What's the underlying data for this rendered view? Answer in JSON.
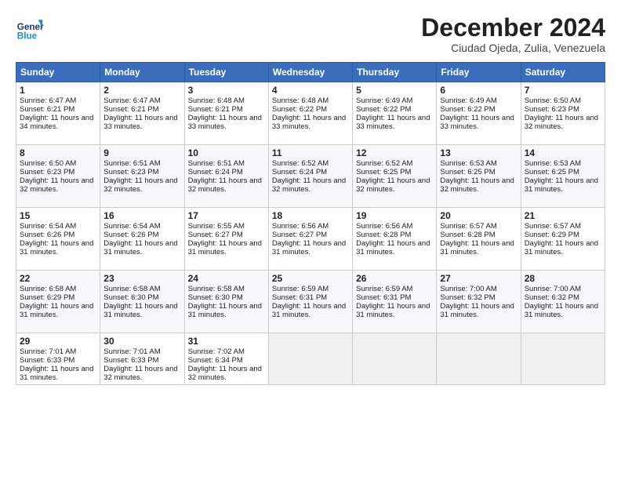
{
  "header": {
    "logo_line1": "General",
    "logo_line2": "Blue",
    "month_title": "December 2024",
    "location": "Ciudad Ojeda, Zulia, Venezuela"
  },
  "weekdays": [
    "Sunday",
    "Monday",
    "Tuesday",
    "Wednesday",
    "Thursday",
    "Friday",
    "Saturday"
  ],
  "weeks": [
    [
      {
        "day": "1",
        "sunrise": "6:47 AM",
        "sunset": "6:21 PM",
        "daylight": "11 hours and 34 minutes."
      },
      {
        "day": "2",
        "sunrise": "6:47 AM",
        "sunset": "6:21 PM",
        "daylight": "11 hours and 33 minutes."
      },
      {
        "day": "3",
        "sunrise": "6:48 AM",
        "sunset": "6:21 PM",
        "daylight": "11 hours and 33 minutes."
      },
      {
        "day": "4",
        "sunrise": "6:48 AM",
        "sunset": "6:22 PM",
        "daylight": "11 hours and 33 minutes."
      },
      {
        "day": "5",
        "sunrise": "6:49 AM",
        "sunset": "6:22 PM",
        "daylight": "11 hours and 33 minutes."
      },
      {
        "day": "6",
        "sunrise": "6:49 AM",
        "sunset": "6:22 PM",
        "daylight": "11 hours and 33 minutes."
      },
      {
        "day": "7",
        "sunrise": "6:50 AM",
        "sunset": "6:23 PM",
        "daylight": "11 hours and 32 minutes."
      }
    ],
    [
      {
        "day": "8",
        "sunrise": "6:50 AM",
        "sunset": "6:23 PM",
        "daylight": "11 hours and 32 minutes."
      },
      {
        "day": "9",
        "sunrise": "6:51 AM",
        "sunset": "6:23 PM",
        "daylight": "11 hours and 32 minutes."
      },
      {
        "day": "10",
        "sunrise": "6:51 AM",
        "sunset": "6:24 PM",
        "daylight": "11 hours and 32 minutes."
      },
      {
        "day": "11",
        "sunrise": "6:52 AM",
        "sunset": "6:24 PM",
        "daylight": "11 hours and 32 minutes."
      },
      {
        "day": "12",
        "sunrise": "6:52 AM",
        "sunset": "6:25 PM",
        "daylight": "11 hours and 32 minutes."
      },
      {
        "day": "13",
        "sunrise": "6:53 AM",
        "sunset": "6:25 PM",
        "daylight": "11 hours and 32 minutes."
      },
      {
        "day": "14",
        "sunrise": "6:53 AM",
        "sunset": "6:25 PM",
        "daylight": "11 hours and 31 minutes."
      }
    ],
    [
      {
        "day": "15",
        "sunrise": "6:54 AM",
        "sunset": "6:26 PM",
        "daylight": "11 hours and 31 minutes."
      },
      {
        "day": "16",
        "sunrise": "6:54 AM",
        "sunset": "6:26 PM",
        "daylight": "11 hours and 31 minutes."
      },
      {
        "day": "17",
        "sunrise": "6:55 AM",
        "sunset": "6:27 PM",
        "daylight": "11 hours and 31 minutes."
      },
      {
        "day": "18",
        "sunrise": "6:56 AM",
        "sunset": "6:27 PM",
        "daylight": "11 hours and 31 minutes."
      },
      {
        "day": "19",
        "sunrise": "6:56 AM",
        "sunset": "6:28 PM",
        "daylight": "11 hours and 31 minutes."
      },
      {
        "day": "20",
        "sunrise": "6:57 AM",
        "sunset": "6:28 PM",
        "daylight": "11 hours and 31 minutes."
      },
      {
        "day": "21",
        "sunrise": "6:57 AM",
        "sunset": "6:29 PM",
        "daylight": "11 hours and 31 minutes."
      }
    ],
    [
      {
        "day": "22",
        "sunrise": "6:58 AM",
        "sunset": "6:29 PM",
        "daylight": "11 hours and 31 minutes."
      },
      {
        "day": "23",
        "sunrise": "6:58 AM",
        "sunset": "6:30 PM",
        "daylight": "11 hours and 31 minutes."
      },
      {
        "day": "24",
        "sunrise": "6:58 AM",
        "sunset": "6:30 PM",
        "daylight": "11 hours and 31 minutes."
      },
      {
        "day": "25",
        "sunrise": "6:59 AM",
        "sunset": "6:31 PM",
        "daylight": "11 hours and 31 minutes."
      },
      {
        "day": "26",
        "sunrise": "6:59 AM",
        "sunset": "6:31 PM",
        "daylight": "11 hours and 31 minutes."
      },
      {
        "day": "27",
        "sunrise": "7:00 AM",
        "sunset": "6:32 PM",
        "daylight": "11 hours and 31 minutes."
      },
      {
        "day": "28",
        "sunrise": "7:00 AM",
        "sunset": "6:32 PM",
        "daylight": "11 hours and 31 minutes."
      }
    ],
    [
      {
        "day": "29",
        "sunrise": "7:01 AM",
        "sunset": "6:33 PM",
        "daylight": "11 hours and 31 minutes."
      },
      {
        "day": "30",
        "sunrise": "7:01 AM",
        "sunset": "6:33 PM",
        "daylight": "11 hours and 32 minutes."
      },
      {
        "day": "31",
        "sunrise": "7:02 AM",
        "sunset": "6:34 PM",
        "daylight": "11 hours and 32 minutes."
      },
      null,
      null,
      null,
      null
    ]
  ]
}
